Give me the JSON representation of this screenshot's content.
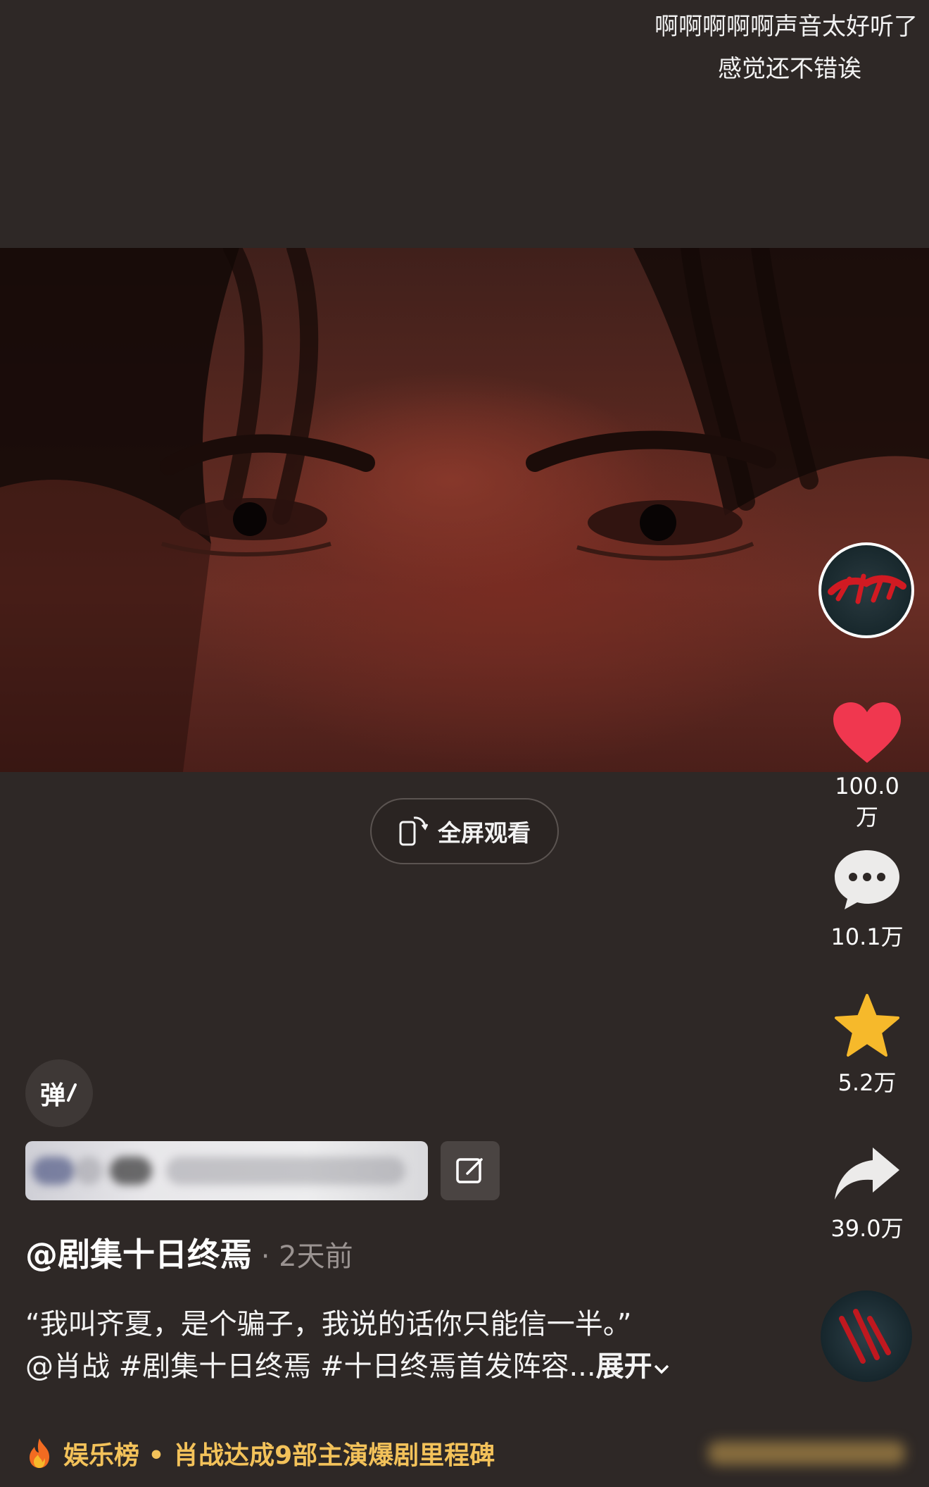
{
  "danmu": [
    "啊啊啊啊啊声音太好听了",
    "感觉还不错诶"
  ],
  "fullscreen_label": "全屏观看",
  "actions": {
    "likes": "100.0万",
    "comments": "10.1万",
    "favorites": "5.2万",
    "shares": "39.0万"
  },
  "danmaku_toggle_label": "弹",
  "author": "@剧集十日终焉",
  "posted": " · 2天前",
  "description": {
    "line1": "“我叫齐夏，是个骗子，我说的话你只能信一半。”",
    "line2": "@肖战 #剧集十日终焉 #十日终焉首发阵容...",
    "expand": "展开"
  },
  "hot_banner": "娱乐榜 • 肖战达成9部主演爆剧里程碑",
  "colors": {
    "background": "#2e2826",
    "like": "#f0374f",
    "star": "#f6b92b",
    "hot_text": "#f3c25a"
  }
}
